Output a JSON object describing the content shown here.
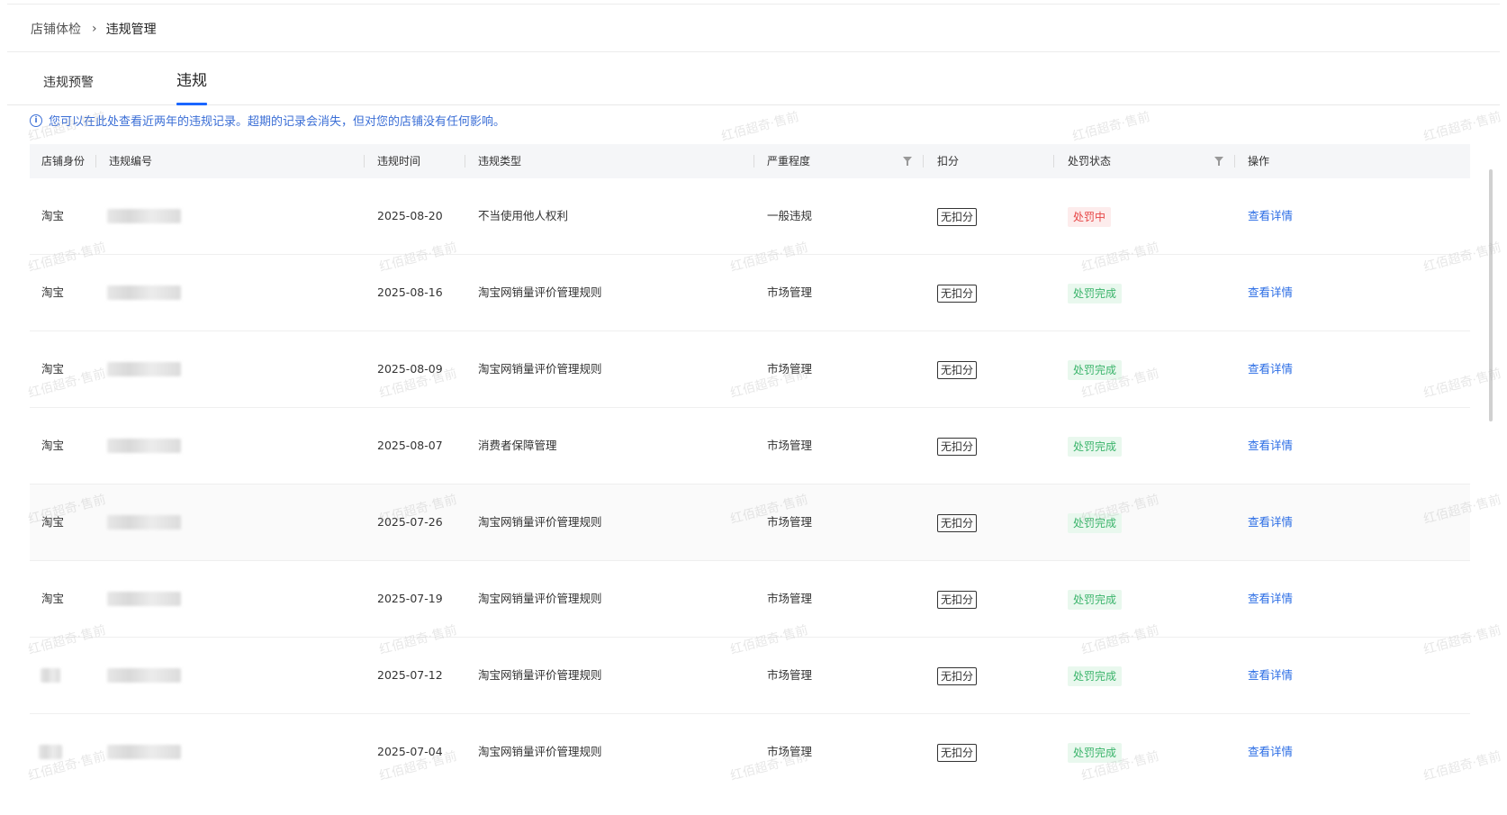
{
  "breadcrumb": {
    "parent": "店铺体检",
    "separator": "›",
    "current": "违规管理"
  },
  "tabs": [
    {
      "label": "违规预警",
      "active": false
    },
    {
      "label": "违规",
      "active": true
    }
  ],
  "notice": {
    "icon": "info-icon",
    "text": "您可以在此处查看近两年的违规记录。超期的记录会消失，但对您的店铺没有任何影响。"
  },
  "table": {
    "columns": [
      "店铺身份",
      "违规编号",
      "违规时间",
      "违规类型",
      "严重程度",
      "扣分",
      "处罚状态",
      "操作"
    ],
    "rows": [
      {
        "shop": "淘宝",
        "date": "2025-08-20",
        "type": "不当使用他人权利",
        "severity": "一般违规",
        "score": "无扣分",
        "status": "处罚中",
        "status_kind": "red",
        "action": "查看详情"
      },
      {
        "shop": "淘宝",
        "date": "2025-08-16",
        "type": "淘宝网销量评价管理规则",
        "severity": "市场管理",
        "score": "无扣分",
        "status": "处罚完成",
        "status_kind": "green",
        "action": "查看详情"
      },
      {
        "shop": "淘宝",
        "date": "2025-08-09",
        "type": "淘宝网销量评价管理规则",
        "severity": "市场管理",
        "score": "无扣分",
        "status": "处罚完成",
        "status_kind": "green",
        "action": "查看详情"
      },
      {
        "shop": "淘宝",
        "date": "2025-08-07",
        "type": "消费者保障管理",
        "severity": "市场管理",
        "score": "无扣分",
        "status": "处罚完成",
        "status_kind": "green",
        "action": "查看详情"
      },
      {
        "shop": "淘宝",
        "date": "2025-07-26",
        "type": "淘宝网销量评价管理规则",
        "severity": "市场管理",
        "score": "无扣分",
        "status": "处罚完成",
        "status_kind": "green",
        "action": "查看详情"
      },
      {
        "shop": "淘宝",
        "date": "2025-07-19",
        "type": "淘宝网销量评价管理规则",
        "severity": "市场管理",
        "score": "无扣分",
        "status": "处罚完成",
        "status_kind": "green",
        "action": "查看详情"
      },
      {
        "shop": "",
        "date": "2025-07-12",
        "type": "淘宝网销量评价管理规则",
        "severity": "市场管理",
        "score": "无扣分",
        "status": "处罚完成",
        "status_kind": "green",
        "action": "查看详情"
      },
      {
        "shop": "",
        "date": "2025-07-04",
        "type": "淘宝网销量评价管理规则",
        "severity": "市场管理",
        "score": "无扣分",
        "status": "处罚完成",
        "status_kind": "green",
        "action": "查看详情"
      }
    ]
  },
  "watermark_text": "红佰超奇·售前",
  "colors": {
    "accent": "#1a66ff",
    "link": "#2b6de5",
    "status_red": "#e64545",
    "status_green": "#3bb46b"
  }
}
